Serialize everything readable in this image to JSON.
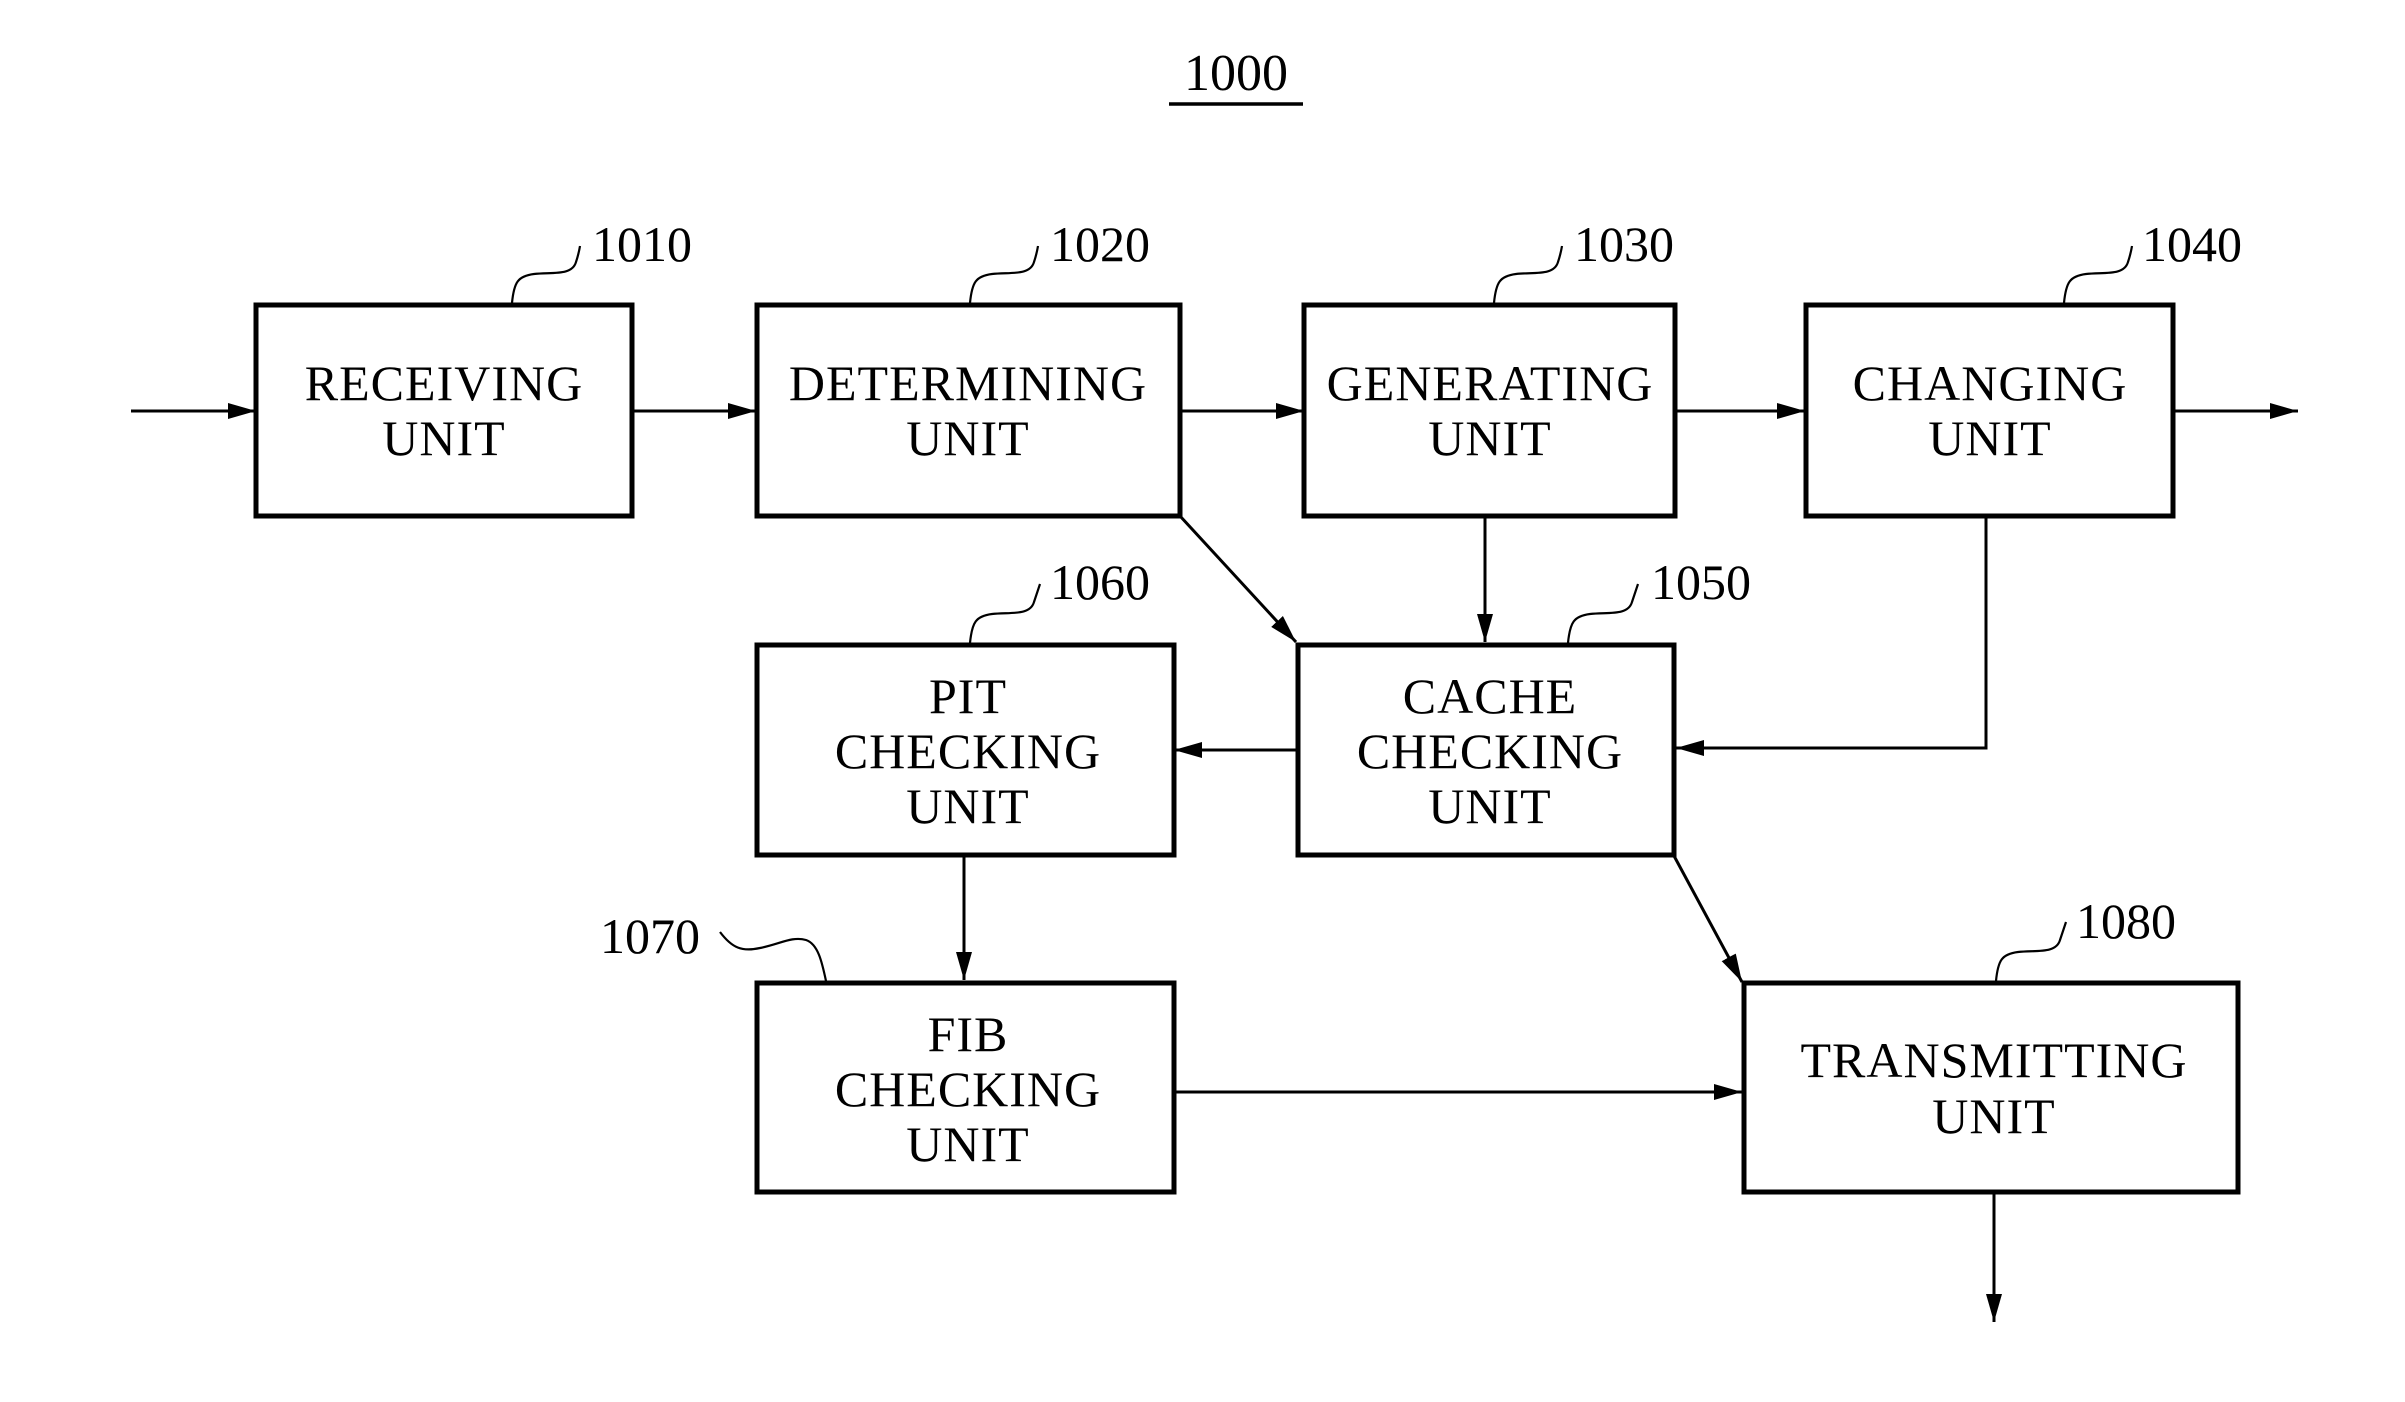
{
  "figure": {
    "title": "1000",
    "units": [
      {
        "id": "receiving",
        "ref": "1010",
        "lines": [
          "RECEIVING",
          "UNIT"
        ]
      },
      {
        "id": "determining",
        "ref": "1020",
        "lines": [
          "DETERMINING",
          "UNIT"
        ]
      },
      {
        "id": "generating",
        "ref": "1030",
        "lines": [
          "GENERATING",
          "UNIT"
        ]
      },
      {
        "id": "changing",
        "ref": "1040",
        "lines": [
          "CHANGING",
          "UNIT"
        ]
      },
      {
        "id": "cache",
        "ref": "1050",
        "lines": [
          "CACHE",
          "CHECKING",
          "UNIT"
        ]
      },
      {
        "id": "pit",
        "ref": "1060",
        "lines": [
          "PIT",
          "CHECKING",
          "UNIT"
        ]
      },
      {
        "id": "fib",
        "ref": "1070",
        "lines": [
          "FIB",
          "CHECKING",
          "UNIT"
        ]
      },
      {
        "id": "transmitting",
        "ref": "1080",
        "lines": [
          "TRANSMITTING",
          "UNIT"
        ]
      }
    ],
    "connections": [
      {
        "from": "input",
        "to": "receiving"
      },
      {
        "from": "receiving",
        "to": "determining"
      },
      {
        "from": "determining",
        "to": "generating"
      },
      {
        "from": "generating",
        "to": "changing"
      },
      {
        "from": "changing",
        "to": "output"
      },
      {
        "from": "determining",
        "to": "cache"
      },
      {
        "from": "generating",
        "to": "cache"
      },
      {
        "from": "changing",
        "to": "cache"
      },
      {
        "from": "cache",
        "to": "pit"
      },
      {
        "from": "cache",
        "to": "transmitting"
      },
      {
        "from": "pit",
        "to": "fib"
      },
      {
        "from": "fib",
        "to": "transmitting"
      },
      {
        "from": "transmitting",
        "to": "output"
      }
    ]
  }
}
